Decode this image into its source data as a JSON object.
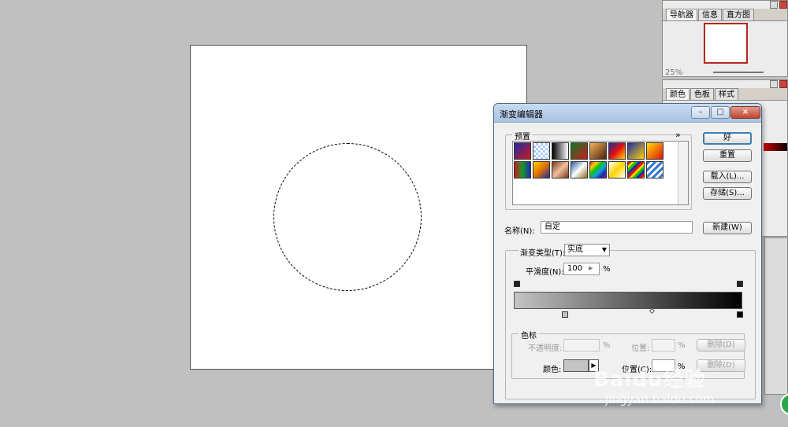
{
  "navigator_panel": {
    "tabs": [
      "导航器",
      "信息",
      "直方图"
    ],
    "zoom": "25%"
  },
  "color_panel": {
    "tabs": [
      "颜色",
      "色板",
      "样式"
    ]
  },
  "dialog": {
    "title": "渐变编辑器",
    "presets_label": "预置",
    "presets_menu": "»",
    "ok_label": "好",
    "reset_label": "重置",
    "load_label": "载入(L)...",
    "save_label": "存储(S)...",
    "name_label": "名称(N):",
    "name_value": "自定",
    "new_label": "新建(W)",
    "gradient_type_label": "渐变类型(T):",
    "gradient_type_value": "实底",
    "smoothness_label": "平滑度(N):",
    "smoothness_value": "100",
    "smoothness_unit": "%",
    "color_stops_label": "色标",
    "opacity_label": "不透明度:",
    "opacity_unit": "%",
    "opacity_location_label": "位置:",
    "opacity_location_unit": "%",
    "opacity_delete_label": "删除(D)",
    "color_label": "颜色:",
    "color_location_label": "位置(C):",
    "color_location_unit": "%",
    "color_delete_label": "删除(D)",
    "minimize_glyph": "–",
    "maximize_glyph": "□",
    "close_glyph": "×"
  },
  "watermark": {
    "brand": "Baidu经验",
    "url": "jingyan.baidu.com"
  }
}
